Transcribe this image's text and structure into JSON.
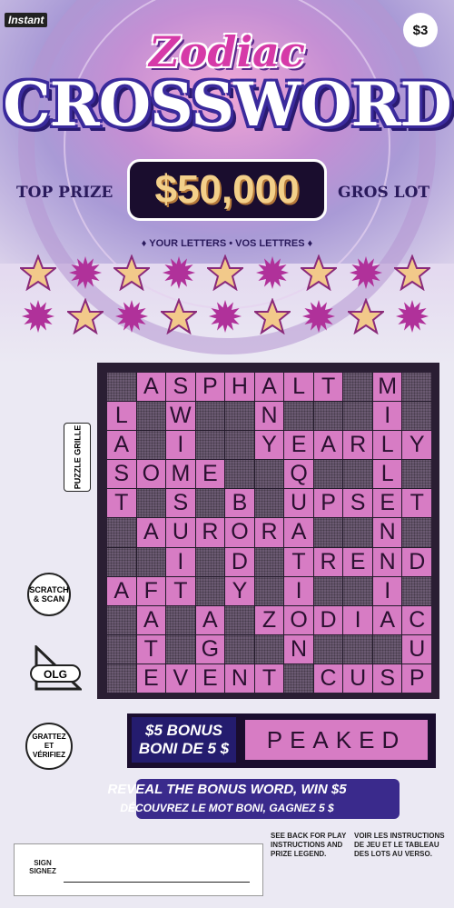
{
  "ticket": {
    "brand_tag": "Instant",
    "price": "$3",
    "title_line1": "Zodiac",
    "title_line2": "CROSSWORD",
    "top_prize_en": "TOP PRIZE",
    "top_prize_fr": "GROS LOT",
    "top_prize_amount": "$50,000",
    "your_letters": "♦ YOUR LETTERS • VOS LETTRES ♦"
  },
  "your_letter_symbols": {
    "row1": [
      "star",
      "sun",
      "star",
      "sun",
      "star",
      "sun",
      "star",
      "sun",
      "star"
    ],
    "row2": [
      "sun",
      "star",
      "sun",
      "star",
      "sun",
      "star",
      "sun",
      "star",
      "sun"
    ]
  },
  "side_marks": {
    "puzzle_label": "PUZZLE GRILLE",
    "scratch_scan": "SCRATCH & SCAN",
    "olg": "OLG",
    "grattez": "GRATTEZ ET VÉRIFIEZ"
  },
  "crossword": {
    "rows": [
      "#ASPHALT#M#",
      "L#W##N###I#",
      "A#I##YEARLY",
      "SOME##Q##L#",
      "T#S#B#UPSET",
      "#AURORA##N#",
      "##I#D#TREND",
      "AFT#Y#I##I#",
      "#A#A#ZODIAC",
      "#T#G##N###U",
      "#EVENT#CUSP"
    ]
  },
  "bonus": {
    "label_en": "$5 BONUS",
    "label_fr": "BONI DE 5 $",
    "word": "PEAKED",
    "reveal_en": "REVEAL THE BONUS WORD, WIN $5",
    "reveal_fr": "DÉCOUVREZ LE MOT BONI, GAGNEZ 5 $"
  },
  "footer": {
    "see_back": "SEE BACK FOR PLAY INSTRUCTIONS AND PRIZE LEGEND.",
    "voir": "VOIR LES INSTRUCTIONS DE JEU ET LE TABLEAU DES LOTS AU VERSO.",
    "sign": "SIGN SIGNEZ"
  },
  "colors": {
    "cell_on": "#d77cc4",
    "cell_off": "#6b5a72",
    "star_gold": "#f2c98a",
    "sun_magenta": "#b0319a"
  }
}
